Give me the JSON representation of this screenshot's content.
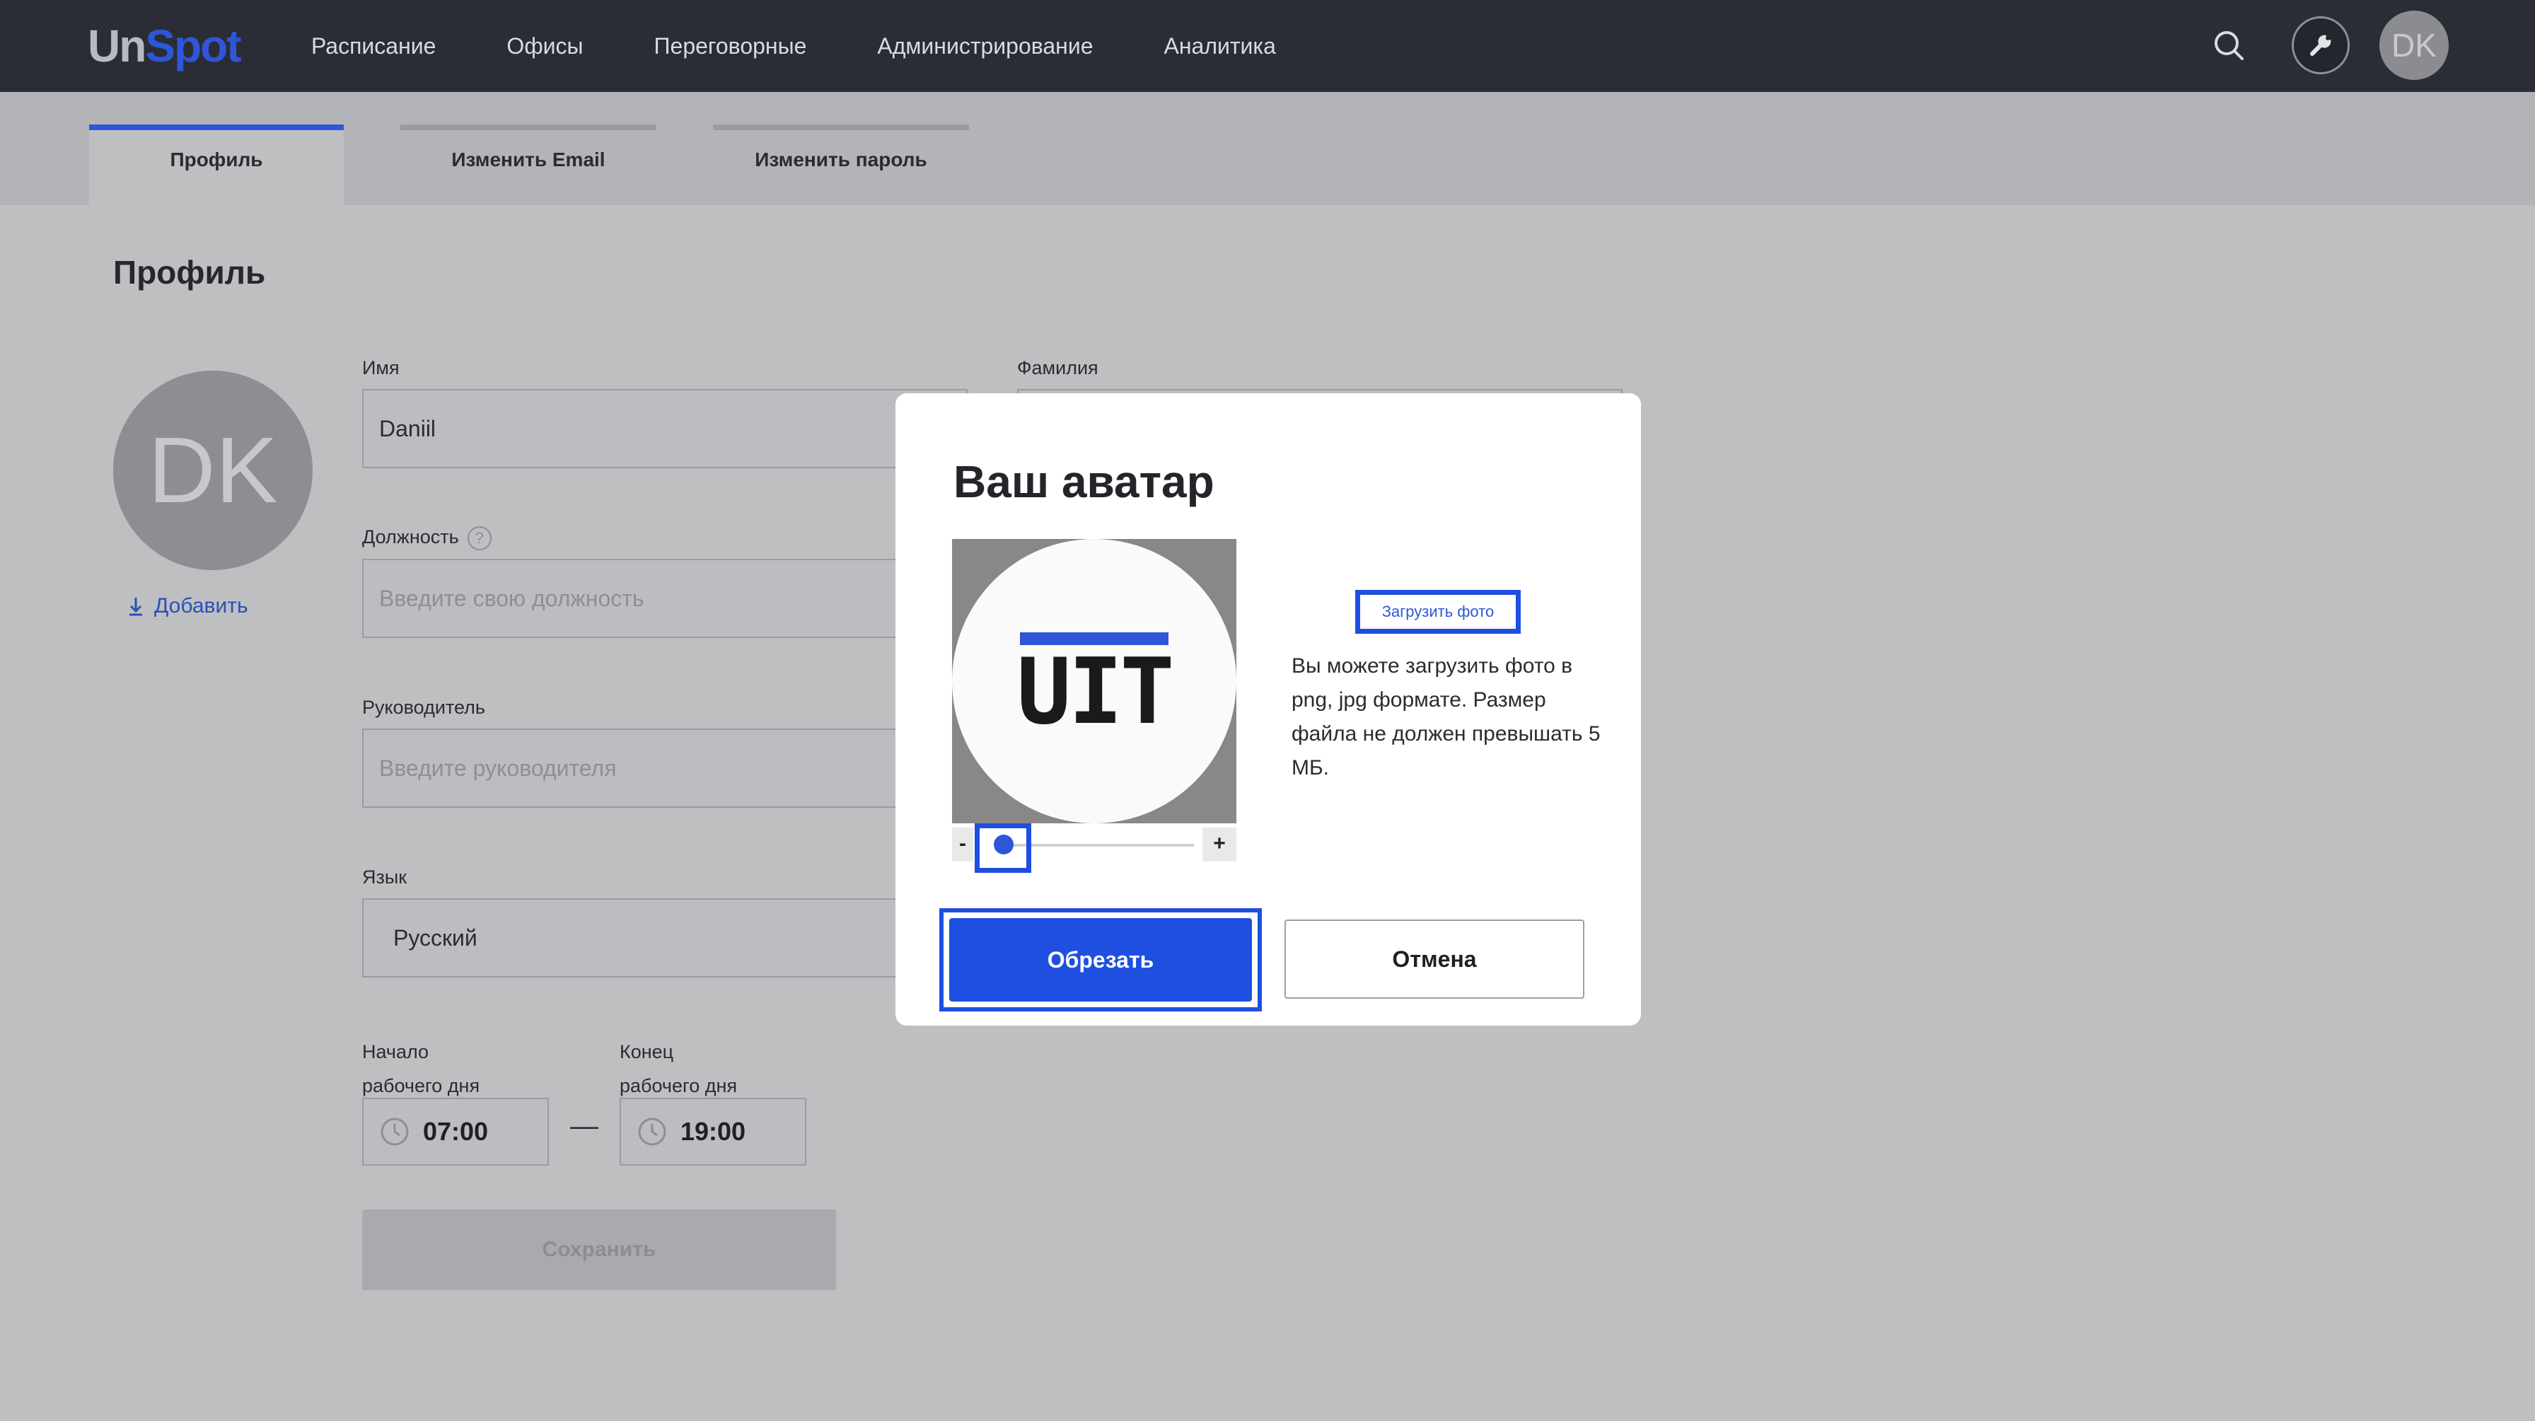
{
  "app": {
    "logo_un": "Un",
    "logo_spot": "Spot",
    "nav": [
      "Расписание",
      "Офисы",
      "Переговорные",
      "Администрирование",
      "Аналитика"
    ],
    "avatar_initials": "DK"
  },
  "tabs": [
    "Профиль",
    "Изменить Email",
    "Изменить пароль"
  ],
  "profile": {
    "title": "Профиль",
    "avatar_initials": "DK",
    "add_label": "Добавить",
    "first_name_label": "Имя",
    "first_name_value": "Daniil",
    "last_name_label": "Фамилия",
    "position_label": "Должность",
    "position_help": "?",
    "position_placeholder": "Введите свою должность",
    "manager_label": "Руководитель",
    "manager_placeholder": "Введите руководителя",
    "language_label": "Язык",
    "language_value": "Русский",
    "start_label_1": "Начало",
    "start_label_2": "рабочего дня",
    "start_value": "07:00",
    "end_label_1": "Конец",
    "end_label_2": "рабочего дня",
    "end_value": "19:00",
    "dash": "—",
    "save_label": "Сохранить"
  },
  "modal": {
    "title": "Ваш аватар",
    "preview_text": "UIT",
    "zoom_minus": "-",
    "zoom_plus": "+",
    "upload_label": "Загрузить фото",
    "note": "Вы можете загрузить фото в png, jpg формате. Размер файла не должен превышать 5 МБ.",
    "crop_label": "Обрезать",
    "cancel_label": "Отмена"
  },
  "icons": {
    "search": "search-icon",
    "tools": "wrench-icon",
    "clock": "clock-icon",
    "download": "download-arrow-icon"
  },
  "colors": {
    "topbar": "#2a2d35",
    "accent": "#2f56d8",
    "highlight": "#1f4fe0",
    "overlay": "#bebfc1",
    "modal_bg": "#ffffff"
  }
}
